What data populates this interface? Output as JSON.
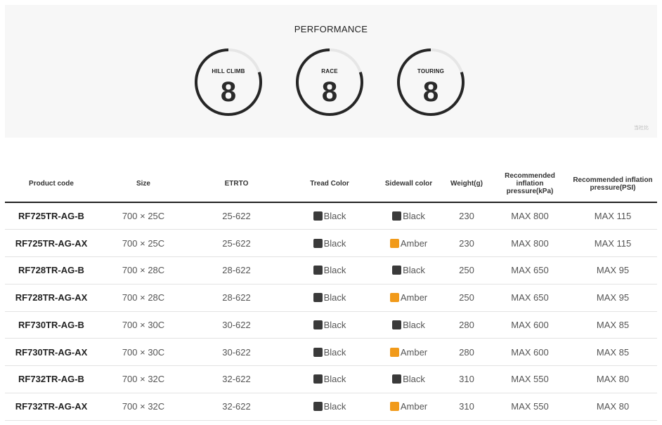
{
  "performance": {
    "title": "PERFORMANCE",
    "max": 10,
    "ratings": [
      {
        "label": "HILL CLIMB",
        "value": 8
      },
      {
        "label": "RACE",
        "value": 8
      },
      {
        "label": "TOURING",
        "value": 8
      }
    ],
    "source_note": "当社比"
  },
  "colors": {
    "Black": "#3a3a3a",
    "Amber": "#f19a1a",
    "gauge_track": "#e6e6e6",
    "gauge_fill": "#262626"
  },
  "table": {
    "headers": [
      "Product code",
      "Size",
      "ETRTO",
      "Tread Color",
      "Sidewall color",
      "Weight(g)",
      "Recommended inflation pressure(kPa)",
      "Recommended inflation pressure(PSI)"
    ],
    "rows": [
      {
        "code": "RF725TR-AG-B",
        "size": "700 × 25C",
        "etrto": "25-622",
        "tread": "Black",
        "sidewall": "Black",
        "weight": "230",
        "kpa": "MAX 800",
        "psi": "MAX 115"
      },
      {
        "code": "RF725TR-AG-AX",
        "size": "700 × 25C",
        "etrto": "25-622",
        "tread": "Black",
        "sidewall": "Amber",
        "weight": "230",
        "kpa": "MAX 800",
        "psi": "MAX 115"
      },
      {
        "code": "RF728TR-AG-B",
        "size": "700 × 28C",
        "etrto": "28-622",
        "tread": "Black",
        "sidewall": "Black",
        "weight": "250",
        "kpa": "MAX 650",
        "psi": "MAX 95"
      },
      {
        "code": "RF728TR-AG-AX",
        "size": "700 × 28C",
        "etrto": "28-622",
        "tread": "Black",
        "sidewall": "Amber",
        "weight": "250",
        "kpa": "MAX 650",
        "psi": "MAX 95"
      },
      {
        "code": "RF730TR-AG-B",
        "size": "700 × 30C",
        "etrto": "30-622",
        "tread": "Black",
        "sidewall": "Black",
        "weight": "280",
        "kpa": "MAX 600",
        "psi": "MAX 85"
      },
      {
        "code": "RF730TR-AG-AX",
        "size": "700 × 30C",
        "etrto": "30-622",
        "tread": "Black",
        "sidewall": "Amber",
        "weight": "280",
        "kpa": "MAX 600",
        "psi": "MAX 85"
      },
      {
        "code": "RF732TR-AG-B",
        "size": "700 × 32C",
        "etrto": "32-622",
        "tread": "Black",
        "sidewall": "Black",
        "weight": "310",
        "kpa": "MAX 550",
        "psi": "MAX 80"
      },
      {
        "code": "RF732TR-AG-AX",
        "size": "700 × 32C",
        "etrto": "32-622",
        "tread": "Black",
        "sidewall": "Amber",
        "weight": "310",
        "kpa": "MAX 550",
        "psi": "MAX 80"
      }
    ]
  }
}
